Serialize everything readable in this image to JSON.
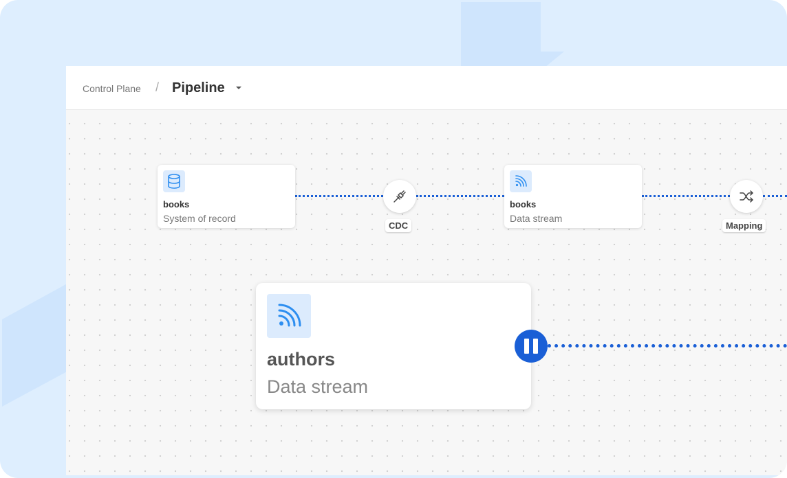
{
  "breadcrumb": {
    "root": "Control Plane",
    "separator": "/",
    "current": "Pipeline"
  },
  "nodes": [
    {
      "title": "books",
      "subtitle": "System of record",
      "icon": "database-icon"
    },
    {
      "title": "books",
      "subtitle": "Data stream",
      "icon": "rss-icon"
    },
    {
      "title": "authors",
      "subtitle": "Data stream",
      "icon": "rss-icon"
    }
  ],
  "connectors": [
    {
      "label": "CDC",
      "icon": "plug-icon"
    },
    {
      "label": "Mapping",
      "icon": "shuffle-icon"
    }
  ],
  "pause_control": {
    "icon": "pause-icon",
    "state": "running"
  },
  "colors": {
    "accent": "#1a5fd6",
    "icon_blue": "#2d8ef0",
    "icon_bg": "#dcebfd",
    "frame_bg": "#deeefe"
  }
}
